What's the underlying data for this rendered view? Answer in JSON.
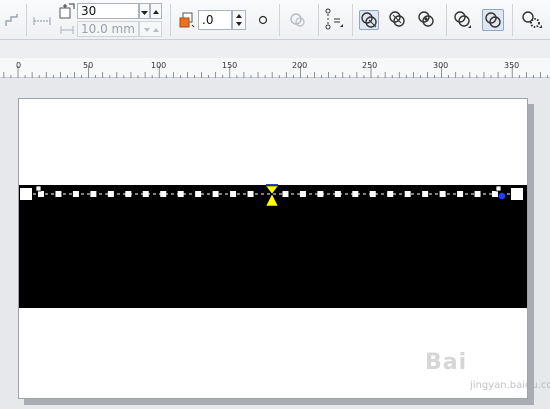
{
  "toolbar": {
    "outline_width_value": "30",
    "spacing_value": "10.0 mm",
    "angle_value": ".0"
  },
  "ruler": {
    "labels": [
      "0",
      "50",
      "100",
      "150",
      "200",
      "250",
      "300",
      "350"
    ]
  },
  "watermark": {
    "text": "Bai",
    "sub_text": "jingyan.baidu.com"
  },
  "colors": {
    "canvas_bg": "#e6e8eb",
    "page": "#ffffff",
    "shape_fill": "#000000",
    "handle_highlight": "#ffff00",
    "selection_blue": "#1f3fff"
  }
}
